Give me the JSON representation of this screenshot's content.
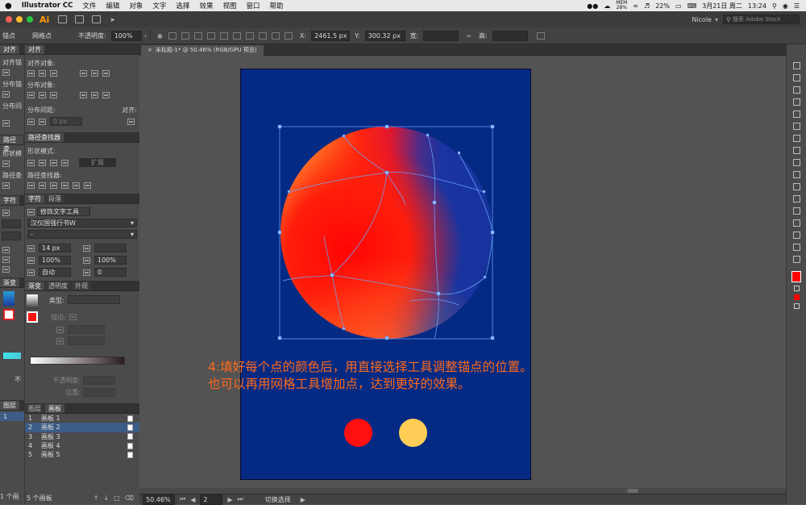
{
  "menubar": {
    "apple": "",
    "app": "Illustrator CC",
    "items": [
      "文件",
      "编辑",
      "对象",
      "文字",
      "选择",
      "效果",
      "视图",
      "窗口",
      "帮助"
    ],
    "status": {
      "mem": "MEM",
      "mem_pct": "28%",
      "battery": "22%",
      "date": "3月21日 周二",
      "time": "13:24"
    }
  },
  "titlebar": {
    "logo": "Ai",
    "user": "Nicole",
    "search_placeholder": "搜索 Adobe Stock"
  },
  "controlbar": {
    "anchor_label": "锚点",
    "mesh_point": "网格点",
    "opacity_label": "不透明度:",
    "opacity_value": "100%",
    "x_label": "X:",
    "x_value": "2461.5 px",
    "y_label": "Y:",
    "y_value": "300.32 px",
    "w_label": "宽:",
    "h_label": "高:"
  },
  "panels": {
    "align": {
      "tab_left": "对齐",
      "tab": "对齐",
      "align_objects": "对齐对象:",
      "distribute_objects": "分布对象:",
      "distribute_spacing": "分布间距:",
      "align_to": "对齐:",
      "left_align_obj": "对齐锚",
      "left_dist_obj": "分布锚",
      "left_dist_space": "分布间",
      "spacing_value": "0 px"
    },
    "pathfinder": {
      "tab_left": "路径查",
      "tab": "路径查找器",
      "shape_modes": "形状模式:",
      "pathfinders": "路径查找器:",
      "expand": "扩展",
      "left_shape": "形状模",
      "left_path": "路径查"
    },
    "character": {
      "tab_left": "字符",
      "tab": "字符",
      "tab2": "段落",
      "tool_hint": "修饰文字工具",
      "font_family": "汉仪国强行书W",
      "font_style": "-",
      "size": "14 px",
      "scale_v": "100%",
      "scale_h": "100%",
      "leading": "自动",
      "tracking": "0"
    },
    "gradient": {
      "tab_left": "渐变",
      "tab": "渐变",
      "tab2": "透明度",
      "tab3": "外观",
      "type_label": "类型:",
      "stroke_label": "描边:",
      "opacity_label": "不透明度:",
      "location_label": "位置:",
      "left_opacity": "不"
    },
    "artboards": {
      "tab_layers": "图层",
      "tab_layers2": "图层",
      "tab": "画板",
      "left_row": "1",
      "rows": [
        {
          "num": "1",
          "name": "画板 1"
        },
        {
          "num": "2",
          "name": "画板 2"
        },
        {
          "num": "3",
          "name": "画板 3"
        },
        {
          "num": "4",
          "name": "画板 4"
        },
        {
          "num": "5",
          "name": "画板 5"
        }
      ],
      "count_left": "1 个画",
      "count": "5 个画板"
    }
  },
  "document": {
    "tab_title": "未标题-1* @ 50.46% (RGB/GPU 预览)"
  },
  "caption": {
    "line1": "4:填好每个点的颜色后，用直接选择工具调整锚点的位置。",
    "line2": "也可以再用网格工具增加点，达到更好的效果。"
  },
  "colors": {
    "artboard_bg": "#052a84",
    "swatch_red": "#ff0f0f",
    "swatch_yellow": "#ffcc55",
    "caption": "#ff6a1a",
    "fill_swatch": "#ff0000"
  },
  "statusbar": {
    "zoom": "50.46%",
    "artboard_num": "2",
    "tool": "切换选择"
  }
}
